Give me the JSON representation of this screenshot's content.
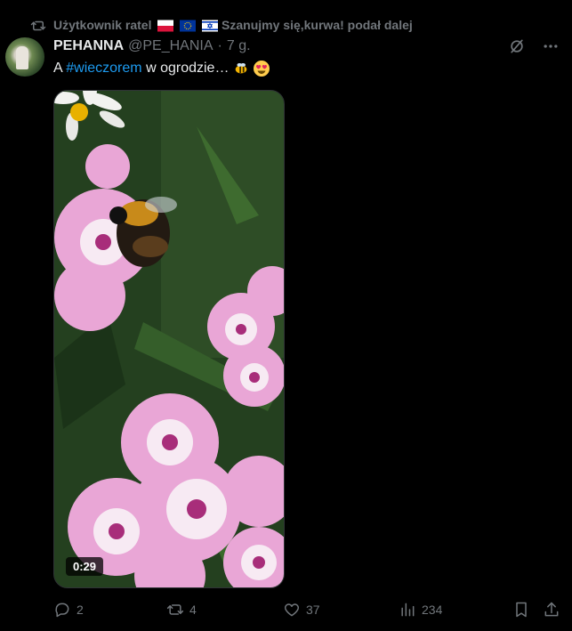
{
  "repost": {
    "icon": "repost-icon",
    "user": "Użytkownik ratel",
    "flags": [
      "flag-poland",
      "flag-eu",
      "flag-israel"
    ],
    "suffix": "Szanujmy się,kurwa! podał dalej"
  },
  "tweet": {
    "author_name": "PEHANNA",
    "author_handle": "@PE_HANIA",
    "separator": "·",
    "time": "7 g.",
    "text_prefix": "A",
    "hashtag": "#wieczorem",
    "text_suffix": "w ogrodzie…",
    "emojis": [
      "bee-emoji",
      "heart-eyes-emoji"
    ]
  },
  "media": {
    "duration": "0:29"
  },
  "actions": {
    "replies": "2",
    "reposts": "4",
    "likes": "37",
    "views": "234"
  },
  "colors": {
    "background": "#000000",
    "text": "#e7e9ea",
    "muted": "#71767b",
    "link": "#1d9bf0"
  }
}
